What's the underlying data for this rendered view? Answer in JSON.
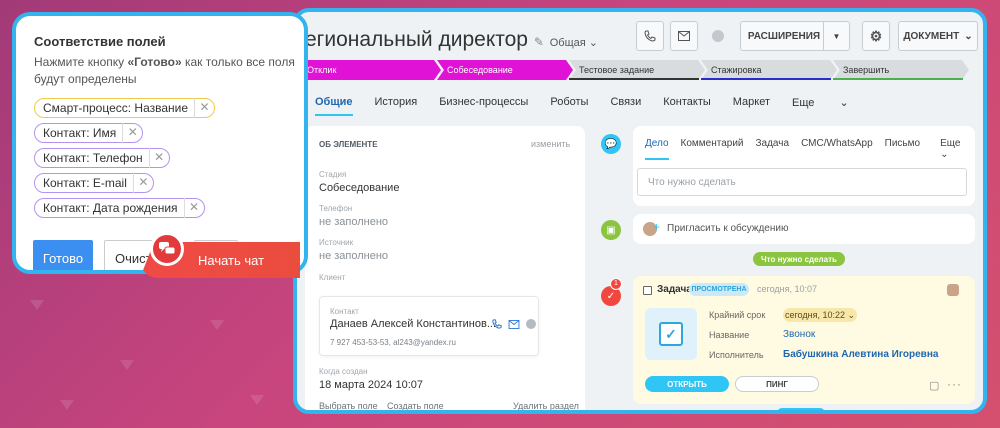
{
  "window": {
    "title": "егиональный директор",
    "category": "Общая",
    "buttons": {
      "extensions": "РАСШИРЕНИЯ",
      "document": "ДОКУМЕНТ"
    }
  },
  "stages": [
    {
      "label": "Отклик",
      "color": "#e012d6",
      "text": "#ffffff"
    },
    {
      "label": "Собеседование",
      "color": "#e012d6",
      "text": "#ffffff"
    },
    {
      "label": "Тестовое задание",
      "color": "#d8dcdf",
      "text": "#333333"
    },
    {
      "label": "Стажировка",
      "color": "#d8dcdf",
      "text": "#333333"
    },
    {
      "label": "Завершить",
      "color": "#d8dcdf",
      "text": "#333333"
    }
  ],
  "tabs": [
    "Общие",
    "История",
    "Бизнес-процессы",
    "Роботы",
    "Связи",
    "Контакты",
    "Маркет",
    "Еще"
  ],
  "about": {
    "header": "ОБ ЭЛЕМЕНТЕ",
    "edit": "изменить",
    "stage_label": "Стадия",
    "stage_value": "Собеседование",
    "phone_label": "Телефон",
    "phone_value": "не заполнено",
    "source_label": "Источник",
    "source_value": "не заполнено",
    "client_label": "Клиент",
    "contact_label": "Контакт",
    "contact_name": "Данаев Алексей Константинов...",
    "contact_info": "7 927 453-53-53, al243@yandex.ru",
    "created_label": "Когда создан",
    "created_value": "18 марта 2024 10:07",
    "select_field": "Выбрать поле",
    "create_field": "Создать поле",
    "delete_section": "Удалить раздел"
  },
  "activity": {
    "tabs": [
      "Дело",
      "Комментарий",
      "Задача",
      "СМС/WhatsApp",
      "Письмо",
      "Еще"
    ],
    "placeholder": "Что нужно сделать",
    "invite": "Пригласить к обсуждению",
    "todo_pill": "Что нужно сделать"
  },
  "task": {
    "title": "Задача",
    "badge": "ПРОСМОТРЕНА",
    "time": "сегодня, 10:07",
    "counter": "1",
    "deadline_label": "Крайний срок",
    "deadline_value": "сегодня, 10:22",
    "name_label": "Название",
    "name_value": "Звонок",
    "executor_label": "Исполнитель",
    "executor_value": "Бабушкина Алевтина Игоревна",
    "open_button": "ОТКРЫТЬ",
    "ping_button": "ПИНГ"
  },
  "panel": {
    "title": "Соответствие полей",
    "desc_prefix": "Нажмите кнопку ",
    "desc_bold": "«Готово»",
    "desc_suffix": " как только все поля будут определены",
    "tags": [
      "Смарт-процесс: Название",
      "Контакт: Имя",
      "Контакт: Телефон",
      "Контакт: E-mail",
      "Контакт: Дата рождения"
    ],
    "ready_button": "Готово",
    "clear_button": "Очисти",
    "chat_button": "Начать чат"
  },
  "colors": {
    "accent": "#34b4ee",
    "link": "#2067b0",
    "ready": "#3b8ff0",
    "chat": "#f04a46"
  }
}
